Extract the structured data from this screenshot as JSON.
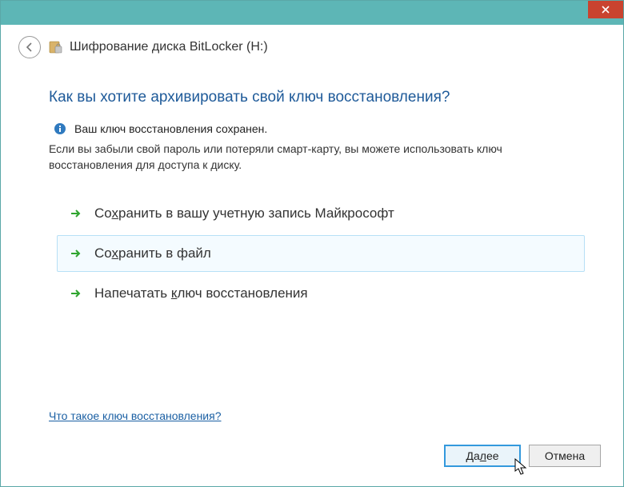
{
  "window_title": "Шифрование диска BitLocker (H:)",
  "question": "Как вы хотите архивировать свой ключ восстановления?",
  "status": "Ваш ключ восстановления сохранен.",
  "description": "Если вы забыли свой пароль или потеряли смарт-карту, вы можете использовать ключ восстановления для доступа к диску.",
  "options": {
    "ms_account_pre": "Со",
    "ms_account_u": "х",
    "ms_account_post": "ранить в вашу учетную запись Майкрософт",
    "file_pre": "Со",
    "file_u": "х",
    "file_post": "ранить в файл",
    "print_pre": "Напечатать ",
    "print_u": "к",
    "print_post": "люч восстановления"
  },
  "help_link": "Что такое ключ восстановления?",
  "buttons": {
    "next_pre": "Да",
    "next_u": "л",
    "next_post": "ее",
    "cancel": "Отмена"
  }
}
